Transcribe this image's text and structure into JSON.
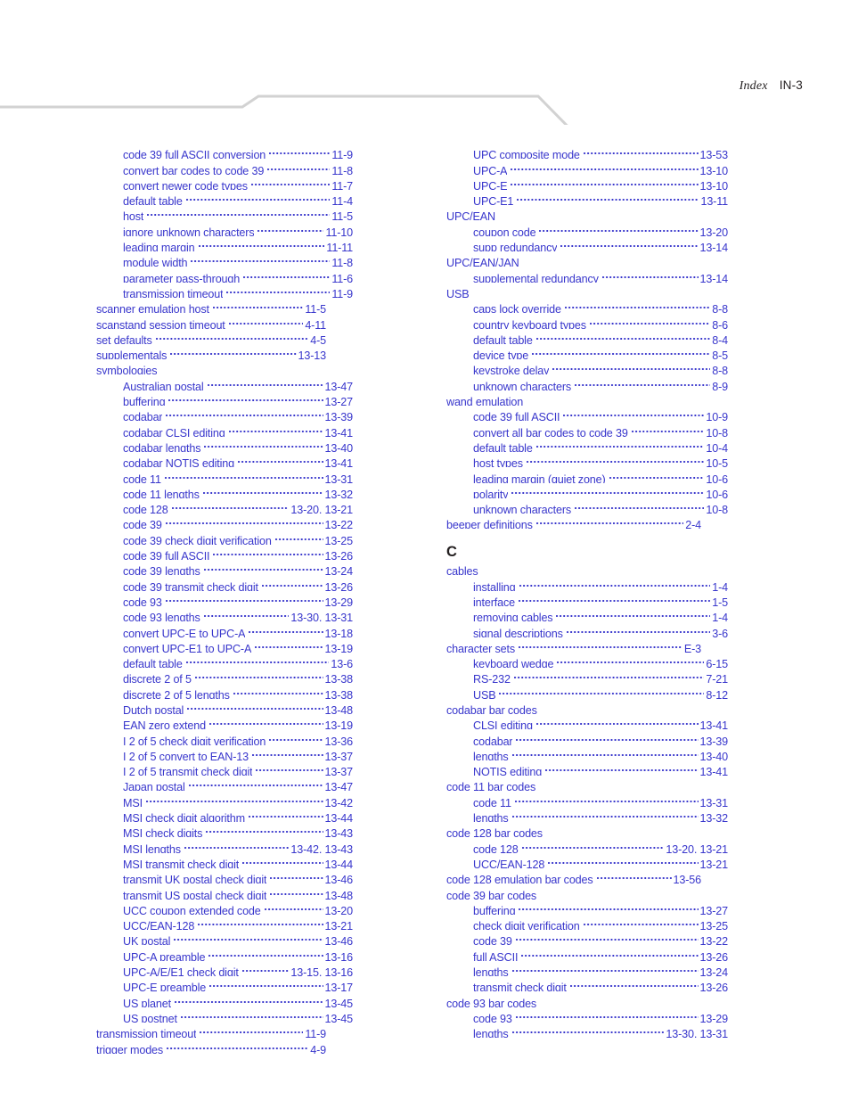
{
  "header": {
    "index_label": "Index",
    "page_label": "IN-3",
    "rule_color": "#d2d2d2"
  },
  "theme": {
    "entry_color": "#3836cc",
    "heading_color": "#231f20",
    "background": "#ffffff"
  },
  "columns": [
    {
      "name": "left-column",
      "entries": [
        {
          "level": 2,
          "title": "code 39 full ASCII conversion",
          "page": "11-9"
        },
        {
          "level": 2,
          "title": "convert bar codes to code 39",
          "page": "11-8"
        },
        {
          "level": 2,
          "title": "convert newer code types",
          "page": "11-7"
        },
        {
          "level": 2,
          "title": "default table",
          "page": "11-4"
        },
        {
          "level": 2,
          "title": "host",
          "page": "11-5"
        },
        {
          "level": 2,
          "title": "ignore unknown characters",
          "page": "11-10"
        },
        {
          "level": 2,
          "title": "leading margin",
          "page": "11-11"
        },
        {
          "level": 2,
          "title": "module width",
          "page": "11-8"
        },
        {
          "level": 2,
          "title": "parameter pass-through",
          "page": "11-6"
        },
        {
          "level": 2,
          "title": "transmission timeout",
          "page": "11-9"
        },
        {
          "level": 1,
          "title": "scanner emulation host",
          "page": "11-5"
        },
        {
          "level": 1,
          "title": "scanstand session timeout",
          "page": "4-11"
        },
        {
          "level": 1,
          "title": "set defaults",
          "page": "4-5"
        },
        {
          "level": 1,
          "title": "supplementals",
          "page": "13-13"
        },
        {
          "level": 1,
          "title": "symbologies",
          "page": ""
        },
        {
          "level": 2,
          "title": "Australian postal",
          "page": "13-47"
        },
        {
          "level": 2,
          "title": "buffering",
          "page": "13-27"
        },
        {
          "level": 2,
          "title": "codabar",
          "page": "13-39"
        },
        {
          "level": 2,
          "title": "codabar CLSI editing",
          "page": "13-41"
        },
        {
          "level": 2,
          "title": "codabar lengths",
          "page": "13-40"
        },
        {
          "level": 2,
          "title": "codabar NOTIS editing",
          "page": "13-41"
        },
        {
          "level": 2,
          "title": "code 11",
          "page": "13-31"
        },
        {
          "level": 2,
          "title": "code 11 lengths",
          "page": "13-32"
        },
        {
          "level": 2,
          "title": "code 128",
          "page": "13-20, 13-21"
        },
        {
          "level": 2,
          "title": "code 39",
          "page": "13-22"
        },
        {
          "level": 2,
          "title": "code 39 check digit verification",
          "page": "13-25"
        },
        {
          "level": 2,
          "title": "code 39 full ASCII",
          "page": "13-26"
        },
        {
          "level": 2,
          "title": "code 39 lengths",
          "page": "13-24"
        },
        {
          "level": 2,
          "title": "code 39 transmit check digit",
          "page": "13-26"
        },
        {
          "level": 2,
          "title": "code 93",
          "page": "13-29"
        },
        {
          "level": 2,
          "title": "code 93 lengths",
          "page": "13-30, 13-31"
        },
        {
          "level": 2,
          "title": "convert UPC-E to UPC-A",
          "page": "13-18"
        },
        {
          "level": 2,
          "title": "convert UPC-E1 to UPC-A",
          "page": "13-19"
        },
        {
          "level": 2,
          "title": "default table",
          "page": "13-6"
        },
        {
          "level": 2,
          "title": "discrete 2 of 5",
          "page": "13-38"
        },
        {
          "level": 2,
          "title": "discrete 2 of 5 lengths",
          "page": "13-38"
        },
        {
          "level": 2,
          "title": "Dutch postal",
          "page": "13-48"
        },
        {
          "level": 2,
          "title": "EAN zero extend",
          "page": "13-19"
        },
        {
          "level": 2,
          "title": "I 2 of 5 check digit verification",
          "page": "13-36"
        },
        {
          "level": 2,
          "title": "I 2 of 5 convert to EAN-13",
          "page": "13-37"
        },
        {
          "level": 2,
          "title": "I 2 of 5 transmit check digit",
          "page": "13-37"
        },
        {
          "level": 2,
          "title": "Japan postal",
          "page": "13-47"
        },
        {
          "level": 2,
          "title": "MSI",
          "page": "13-42"
        },
        {
          "level": 2,
          "title": "MSI check digit algorithm",
          "page": "13-44"
        },
        {
          "level": 2,
          "title": "MSI check digits",
          "page": "13-43"
        },
        {
          "level": 2,
          "title": "MSI lengths",
          "page": "13-42, 13-43"
        },
        {
          "level": 2,
          "title": "MSI transmit check digit",
          "page": "13-44"
        },
        {
          "level": 2,
          "title": "transmit UK postal check digit",
          "page": "13-46"
        },
        {
          "level": 2,
          "title": "transmit US postal check digit",
          "page": "13-48"
        },
        {
          "level": 2,
          "title": "UCC coupon extended code",
          "page": "13-20"
        },
        {
          "level": 2,
          "title": "UCC/EAN-128",
          "page": "13-21"
        },
        {
          "level": 2,
          "title": "UK postal",
          "page": "13-46"
        },
        {
          "level": 2,
          "title": "UPC-A preamble",
          "page": "13-16"
        },
        {
          "level": 2,
          "title": "UPC-A/E/E1 check digit",
          "page": "13-15, 13-16"
        },
        {
          "level": 2,
          "title": "UPC-E preamble",
          "page": "13-17"
        },
        {
          "level": 2,
          "title": "US planet",
          "page": "13-45"
        },
        {
          "level": 2,
          "title": "US postnet",
          "page": "13-45"
        },
        {
          "level": 1,
          "title": "transmission timeout",
          "page": "11-9"
        },
        {
          "level": 1,
          "title": "trigger modes",
          "page": "4-9"
        }
      ]
    },
    {
      "name": "right-column",
      "entries": [
        {
          "level": 2,
          "title": "UPC composite mode",
          "page": "13-53"
        },
        {
          "level": 2,
          "title": "UPC-A",
          "page": "13-10"
        },
        {
          "level": 2,
          "title": "UPC-E",
          "page": "13-10"
        },
        {
          "level": 2,
          "title": "UPC-E1",
          "page": "13-11"
        },
        {
          "level": 1,
          "title": "UPC/EAN",
          "page": ""
        },
        {
          "level": 2,
          "title": "coupon code",
          "page": "13-20"
        },
        {
          "level": 2,
          "title": "supp redundancy",
          "page": "13-14"
        },
        {
          "level": 1,
          "title": "UPC/EAN/JAN",
          "page": ""
        },
        {
          "level": 2,
          "title": "supplemental redundancy",
          "page": "13-14"
        },
        {
          "level": 1,
          "title": "USB",
          "page": ""
        },
        {
          "level": 2,
          "title": "caps lock override",
          "page": "8-8"
        },
        {
          "level": 2,
          "title": "country keyboard types",
          "page": "8-6"
        },
        {
          "level": 2,
          "title": "default table",
          "page": "8-4"
        },
        {
          "level": 2,
          "title": "device type",
          "page": "8-5"
        },
        {
          "level": 2,
          "title": "keystroke delay",
          "page": "8-8"
        },
        {
          "level": 2,
          "title": "unknown characters",
          "page": "8-9"
        },
        {
          "level": 1,
          "title": "wand emulation",
          "page": ""
        },
        {
          "level": 2,
          "title": "code 39 full ASCII",
          "page": "10-9"
        },
        {
          "level": 2,
          "title": "convert all bar codes to code 39",
          "page": "10-8"
        },
        {
          "level": 2,
          "title": "default table",
          "page": "10-4"
        },
        {
          "level": 2,
          "title": "host types",
          "page": "10-5"
        },
        {
          "level": 2,
          "title": "leading margin (quiet zone)",
          "page": "10-6"
        },
        {
          "level": 2,
          "title": "polarity",
          "page": "10-6"
        },
        {
          "level": 2,
          "title": "unknown characters",
          "page": "10-8"
        },
        {
          "level": 1,
          "title": "beeper definitions",
          "page": "2-4"
        },
        {
          "level": 0,
          "title": "",
          "page": ""
        },
        {
          "level": -1,
          "title": "C",
          "page": ""
        },
        {
          "level": 1,
          "title": "cables",
          "page": ""
        },
        {
          "level": 2,
          "title": "installing",
          "page": "1-4"
        },
        {
          "level": 2,
          "title": "interface",
          "page": "1-5"
        },
        {
          "level": 2,
          "title": "removing cables",
          "page": "1-4"
        },
        {
          "level": 2,
          "title": "signal descriptions",
          "page": "3-6"
        },
        {
          "level": 1,
          "title": "character sets",
          "page": "E-3"
        },
        {
          "level": 2,
          "title": "keyboard wedge",
          "page": "6-15"
        },
        {
          "level": 2,
          "title": "RS-232",
          "page": "7-21"
        },
        {
          "level": 2,
          "title": "USB",
          "page": "8-12"
        },
        {
          "level": 1,
          "title": "codabar bar codes",
          "page": ""
        },
        {
          "level": 2,
          "title": "CLSI editing",
          "page": "13-41"
        },
        {
          "level": 2,
          "title": "codabar",
          "page": "13-39"
        },
        {
          "level": 2,
          "title": "lengths",
          "page": "13-40"
        },
        {
          "level": 2,
          "title": "NOTIS editing",
          "page": "13-41"
        },
        {
          "level": 1,
          "title": "code 11 bar codes",
          "page": ""
        },
        {
          "level": 2,
          "title": "code 11",
          "page": "13-31"
        },
        {
          "level": 2,
          "title": "lengths",
          "page": "13-32"
        },
        {
          "level": 1,
          "title": "code 128 bar codes",
          "page": ""
        },
        {
          "level": 2,
          "title": "code 128",
          "page": "13-20, 13-21"
        },
        {
          "level": 2,
          "title": "UCC/EAN-128",
          "page": "13-21"
        },
        {
          "level": 1,
          "title": "code 128 emulation bar codes",
          "page": "13-56"
        },
        {
          "level": 1,
          "title": "code 39 bar codes",
          "page": ""
        },
        {
          "level": 2,
          "title": "buffering",
          "page": "13-27"
        },
        {
          "level": 2,
          "title": "check digit verification",
          "page": "13-25"
        },
        {
          "level": 2,
          "title": "code 39",
          "page": "13-22"
        },
        {
          "level": 2,
          "title": "full ASCII",
          "page": "13-26"
        },
        {
          "level": 2,
          "title": "lengths",
          "page": "13-24"
        },
        {
          "level": 2,
          "title": "transmit check digit",
          "page": "13-26"
        },
        {
          "level": 1,
          "title": "code 93 bar codes",
          "page": ""
        },
        {
          "level": 2,
          "title": "code 93",
          "page": "13-29"
        },
        {
          "level": 2,
          "title": "lengths",
          "page": "13-30, 13-31"
        }
      ]
    }
  ]
}
